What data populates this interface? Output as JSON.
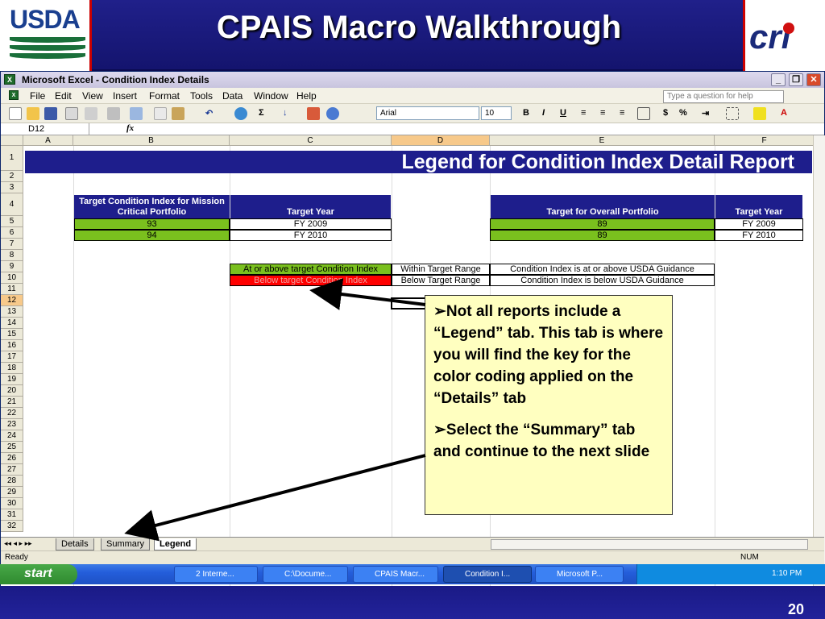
{
  "slide": {
    "title": "CPAIS Macro Walkthrough",
    "left_logo": "USDA",
    "right_logo": "cri",
    "page_number": "20"
  },
  "excel": {
    "window_title": "Microsoft Excel - Condition Index Details",
    "menu": [
      "File",
      "Edit",
      "View",
      "Insert",
      "Format",
      "Tools",
      "Data",
      "Window",
      "Help"
    ],
    "ask_placeholder": "Type a question for help",
    "font_name": "Arial",
    "font_size": "10",
    "name_box": "D12",
    "fx": "fx",
    "columns": [
      "A",
      "B",
      "C",
      "D",
      "E",
      "F"
    ],
    "rows": [
      "1",
      "2",
      "3",
      "4",
      "5",
      "6",
      "7",
      "8",
      "9",
      "10",
      "11",
      "12",
      "13",
      "14",
      "15",
      "16",
      "17",
      "18",
      "19",
      "20",
      "21",
      "22",
      "23",
      "24",
      "25",
      "26",
      "27",
      "28",
      "29",
      "30",
      "31",
      "32"
    ],
    "legend_title": "Legend for Condition Index Detail Report",
    "headers": {
      "target_ci_mission": "Target Condition Index for Mission Critical Portfolio",
      "target_year": "Target Year",
      "target_overall": "Target for Overall Portfolio",
      "target_year_2": "Target Year"
    },
    "targets": [
      {
        "mission_ci": "93",
        "year": "FY 2009",
        "overall": "89",
        "year2": "FY 2009"
      },
      {
        "mission_ci": "94",
        "year": "FY 2010",
        "overall": "89",
        "year2": "FY 2010"
      }
    ],
    "legend_rows": [
      {
        "label": "At or above target Condition Index",
        "range": "Within Target Range",
        "desc": "Condition Index is at or above USDA Guidance"
      },
      {
        "label": "Below target Condition Index",
        "range": "Below Target Range",
        "desc": "Condition Index is below USDA Guidance"
      }
    ],
    "sheet_tabs": [
      "Details",
      "Summary",
      "Legend"
    ],
    "active_tab": "Legend",
    "status_left": "Ready",
    "status_num": "NUM"
  },
  "callout": {
    "bullet_1": "Not all reports include a “Legend” tab.  This tab is where you will find the key for the color coding applied on the “Details” tab",
    "bullet_2": "Select the “Summary” tab and continue to the next slide"
  },
  "taskbar": {
    "start": "start",
    "items": [
      "2 Interne...",
      "C:\\Docume...",
      "CPAIS Macr...",
      "Condition I...",
      "Microsoft P..."
    ],
    "clock": "1:10 PM"
  },
  "colors": {
    "header_navy": "#1e1e8c",
    "green": "#7ac01e",
    "red": "#ff0000",
    "callout_yellow": "#ffffc0"
  }
}
